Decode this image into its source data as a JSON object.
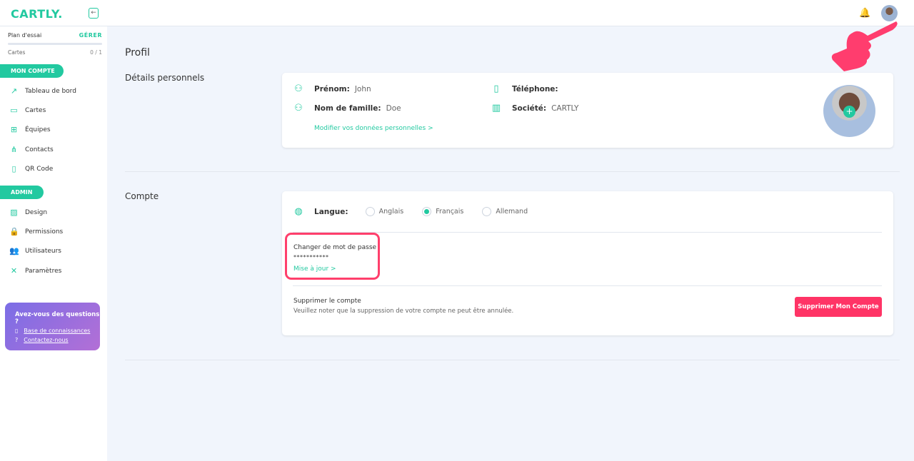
{
  "header": {
    "logo": "CARTLY.",
    "collapse_icon": "←",
    "bell_icon": "🔔"
  },
  "sidebar": {
    "plan": "Plan d'essai",
    "manage": "GÉRER",
    "plan_progress": 0,
    "cards_label": "Cartes",
    "cards_count": "0 / 1",
    "section1": "MON COMPTE",
    "items1": [
      {
        "icon": "↗",
        "label": "Tableau de bord"
      },
      {
        "icon": "▭",
        "label": "Cartes"
      },
      {
        "icon": "⊞",
        "label": "Équipes"
      },
      {
        "icon": "⋔",
        "label": "Contacts"
      },
      {
        "icon": "▯",
        "label": "QR Code"
      }
    ],
    "section2": "ADMIN",
    "items2": [
      {
        "icon": "▨",
        "label": "Design"
      },
      {
        "icon": "🔒",
        "label": "Permissions"
      },
      {
        "icon": "👥",
        "label": "Utilisateurs"
      },
      {
        "icon": "✕",
        "label": "Paramètres"
      }
    ],
    "help": {
      "title": "Avez-vous des questions ?",
      "kb": "Base de connaissances",
      "contact": "Contactez-nous"
    }
  },
  "main": {
    "title": "Profil",
    "personal_title": "Détails personnels",
    "first_name_label": "Prénom:",
    "first_name": "John",
    "last_name_label": "Nom de famille:",
    "last_name": "Doe",
    "phone_label": "Téléphone:",
    "company_label": "Société:",
    "company": "CARTLY",
    "edit_link": "Modifier vos données personnelles >",
    "account_title": "Compte",
    "language_label": "Langue:",
    "languages": [
      "Anglais",
      "Français",
      "Allemand"
    ],
    "selected_language": "Français",
    "password_title": "Changer de mot de passe",
    "password_mask": "***********",
    "password_update": "Mise à jour >",
    "delete_title": "Supprimer le compte",
    "delete_note": "Veuillez noter que la suppression de votre compte ne peut être annulée.",
    "delete_button": "Supprimer Mon Compte"
  },
  "colors": {
    "accent": "#22c9a0",
    "danger": "#ff3466"
  }
}
